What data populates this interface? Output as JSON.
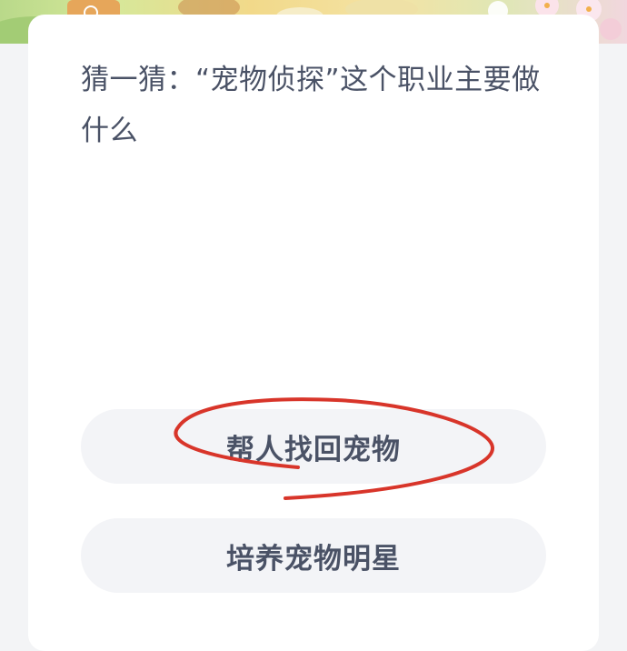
{
  "question": {
    "text": "猜一猜：“宠物侦探”这个职业主要做什么"
  },
  "options": [
    {
      "label": "帮人找回宠物",
      "circled": true
    },
    {
      "label": "培养宠物明星",
      "circled": false
    }
  ],
  "colors": {
    "page_background": "#f3f4f6",
    "card_background": "#ffffff",
    "text": "#4a5266",
    "option_background": "#f3f4f7",
    "annotation_stroke": "#d8352a"
  }
}
